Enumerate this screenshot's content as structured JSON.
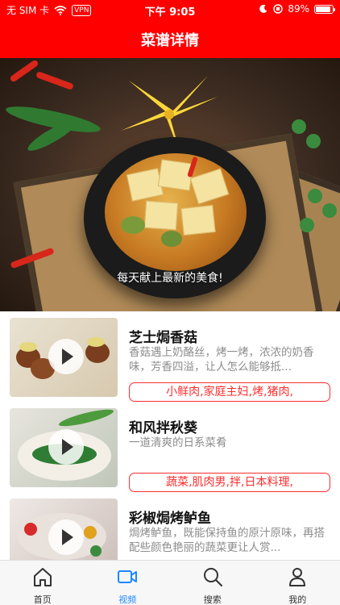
{
  "status_bar": {
    "carrier": "无 SIM 卡",
    "vpn": "VPN",
    "time": "下午 9:05",
    "battery_percent": "89%",
    "battery_level": 0.89,
    "icons": [
      "wifi-icon",
      "moon-icon",
      "lock-rotation-icon",
      "battery-icon"
    ]
  },
  "header": {
    "title": "菜谱详情"
  },
  "hero": {
    "caption": "每天献上最新的美食!"
  },
  "recipes": [
    {
      "name": "芝士焗香菇",
      "desc": "香菇遇上奶酪丝，烤一烤，浓浓的奶香味，芳香四溢，让人怎么能够抵...",
      "tags": "小鲜肉,家庭主妇,烤,猪肉,"
    },
    {
      "name": "和风拌秋葵",
      "desc": "一道清爽的日系菜肴",
      "tags": "蔬菜,肌肉男,拌,日本料理,"
    },
    {
      "name": "彩椒焗烤鲈鱼",
      "desc": "焗烤鲈鱼，既能保持鱼的原汁原味，再搭配些颜色艳丽的蔬菜更让人赏...",
      "tags": ""
    }
  ],
  "tabs": [
    {
      "label": "首页",
      "icon": "home-icon"
    },
    {
      "label": "视频",
      "icon": "video-icon"
    },
    {
      "label": "搜索",
      "icon": "search-icon"
    },
    {
      "label": "我的",
      "icon": "profile-icon"
    }
  ],
  "colors": {
    "header_bg": "#ff0000",
    "tag": "#ff2d2d",
    "active_tab": "#1e88ff"
  }
}
